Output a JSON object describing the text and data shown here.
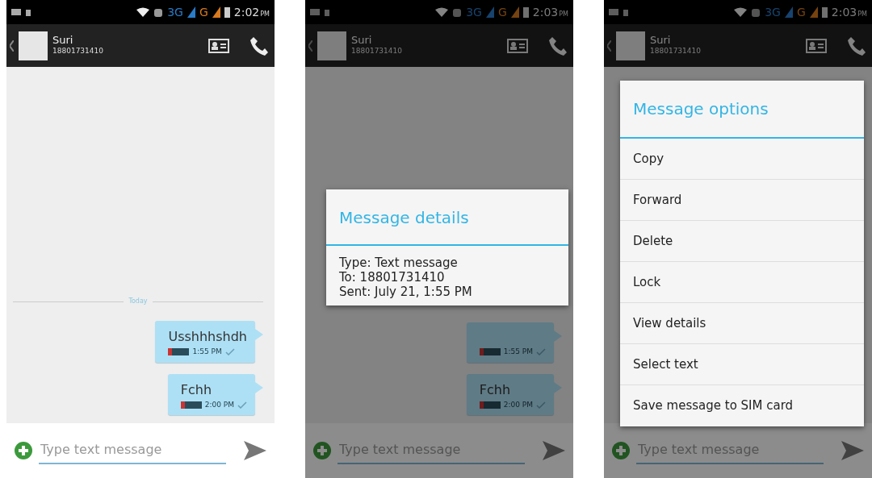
{
  "screens": [
    {
      "status": {
        "net_3g": "3G",
        "net_g": "G",
        "time": "2:02",
        "ampm": "PM"
      },
      "contact": {
        "name": "Suri",
        "number": "18801731410"
      },
      "day_label": "Today",
      "messages": [
        {
          "text": "Usshhhshdh",
          "time": "1:55 PM",
          "delivered": true
        },
        {
          "text": "Fchh",
          "time": "2:00 PM",
          "delivered": true
        }
      ],
      "composer": {
        "placeholder": "Type text message"
      }
    },
    {
      "status": {
        "net_3g": "3G",
        "net_g": "G",
        "time": "2:03",
        "ampm": "PM"
      },
      "contact": {
        "name": "Suri",
        "number": "18801731410"
      },
      "messages": [
        {
          "time": "1:55 PM",
          "delivered": true
        },
        {
          "text": "Fchh",
          "time": "2:00 PM",
          "delivered": true
        }
      ],
      "composer": {
        "placeholder": "Type text message"
      },
      "dialog": {
        "kind": "details",
        "title": "Message details",
        "lines": [
          "Type: Text message",
          "To: 18801731410",
          "Sent: July 21, 1:55 PM"
        ]
      }
    },
    {
      "status": {
        "net_3g": "3G",
        "net_g": "G",
        "time": "2:03",
        "ampm": "PM"
      },
      "contact": {
        "name": "Suri",
        "number": "18801731410"
      },
      "composer": {
        "placeholder": "Type text message"
      },
      "dialog": {
        "kind": "options",
        "title": "Message options",
        "items": [
          "Copy",
          "Forward",
          "Delete",
          "Lock",
          "View details",
          "Select text",
          "Save message to SIM card"
        ]
      }
    }
  ]
}
